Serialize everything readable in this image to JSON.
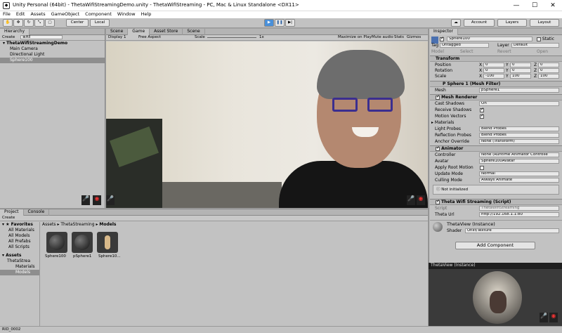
{
  "window": {
    "title": "Unity Personal (64bit) - ThetaWifiStreamingDemo.unity - ThetaWifiStreaming - PC, Mac & Linux Standalone <DX11>",
    "minimize": "—",
    "maximize": "☐",
    "close": "✕",
    "app_icon": "unity-icon"
  },
  "menu": [
    "File",
    "Edit",
    "Assets",
    "GameObject",
    "Component",
    "Window",
    "Help"
  ],
  "toolbar": {
    "center": "Center",
    "local": "Local",
    "account": "Account",
    "layers": "Layers",
    "layout": "Layout",
    "play_icons": [
      "play-icon",
      "pause-icon",
      "step-icon"
    ],
    "cloud_icon": "cloud-icon"
  },
  "hierarchy": {
    "tab": "Hierarchy",
    "create": "Create",
    "search": "≡All",
    "scene": "ThetaWifiStreamingDemo",
    "items": [
      "Main Camera",
      "Directional Light",
      "Sphere100"
    ]
  },
  "game": {
    "tabs": [
      "Scene",
      "Game",
      "Asset Store",
      "Scene"
    ],
    "display": "Display 1",
    "aspect": "Free Aspect",
    "scale_label": "Scale",
    "scale_value": "1x",
    "max_play": "Maximize on Play",
    "mute": "Mute audio",
    "stats": "Stats",
    "gizmos": "Gizmos"
  },
  "project": {
    "tabs": [
      "Project",
      "Console"
    ],
    "create": "Create",
    "favorites": "Favorites",
    "fav_items": [
      "All Materials",
      "All Models",
      "All Prefabs",
      "All Scripts"
    ],
    "assets": "Assets",
    "asset_tree": [
      "ThetaStrea",
      "Materials",
      "Models"
    ],
    "breadcrumb": [
      "Assets",
      "ThetaStreaming",
      "Models"
    ],
    "thumbs": [
      "Sphere100",
      "pSphere1",
      "Sphere10..."
    ],
    "status": "RID_0002"
  },
  "inspector": {
    "tab": "Inspector",
    "name": "Sphere100",
    "static": "Static",
    "tag_label": "Tag",
    "tag": "Untagged",
    "layer_label": "Layer",
    "layer": "Default",
    "model": "Model",
    "select": "Select",
    "revert": "Revert",
    "open": "Open",
    "transform": {
      "title": "Transform",
      "rows": [
        {
          "label": "Position",
          "x": "0",
          "y": "0",
          "z": "0"
        },
        {
          "label": "Rotation",
          "x": "0",
          "y": "0",
          "z": "0"
        },
        {
          "label": "Scale",
          "x": "-100",
          "y": "100",
          "z": "100"
        }
      ]
    },
    "mesh_filter": {
      "title": "P Sphere 1 (Mesh Filter)",
      "label": "Mesh",
      "value": "pSphere1"
    },
    "mesh_renderer": {
      "title": "Mesh Renderer",
      "cast_label": "Cast Shadows",
      "cast": "On",
      "receive": "Receive Shadows",
      "motion": "Motion Vectors",
      "materials": "Materials",
      "light_probes_label": "Light Probes",
      "light_probes": "Blend Probes",
      "reflection_label": "Reflection Probes",
      "reflection": "Blend Probes",
      "anchor_label": "Anchor Override",
      "anchor": "None (Transform)"
    },
    "animator": {
      "title": "Animator",
      "controller_label": "Controller",
      "controller": "None (Runtime Animator Controlle",
      "avatar_label": "Avatar",
      "avatar": "Sphere100Avatar",
      "root_motion": "Apply Root Motion",
      "update_label": "Update Mode",
      "update": "Normal",
      "culling_label": "Culling Mode",
      "culling": "Always Animate",
      "warning": "Not initialized"
    },
    "script": {
      "title": "Theta Wifi Streaming (Script)",
      "script_label": "Script",
      "script": "ThetaWifiStreaming",
      "url_label": "Theta Url",
      "url": "http://192.168.1.1:80"
    },
    "material": {
      "name": "ThetaView (Instance)",
      "shader_label": "Shader",
      "shader": "Unlit/Texture"
    },
    "add_component": "Add Component",
    "preview_title": "ThetaView (Instance)"
  },
  "colors": {
    "play_blue": "#4a90d9",
    "tab_bg": "#c8c8c8"
  }
}
